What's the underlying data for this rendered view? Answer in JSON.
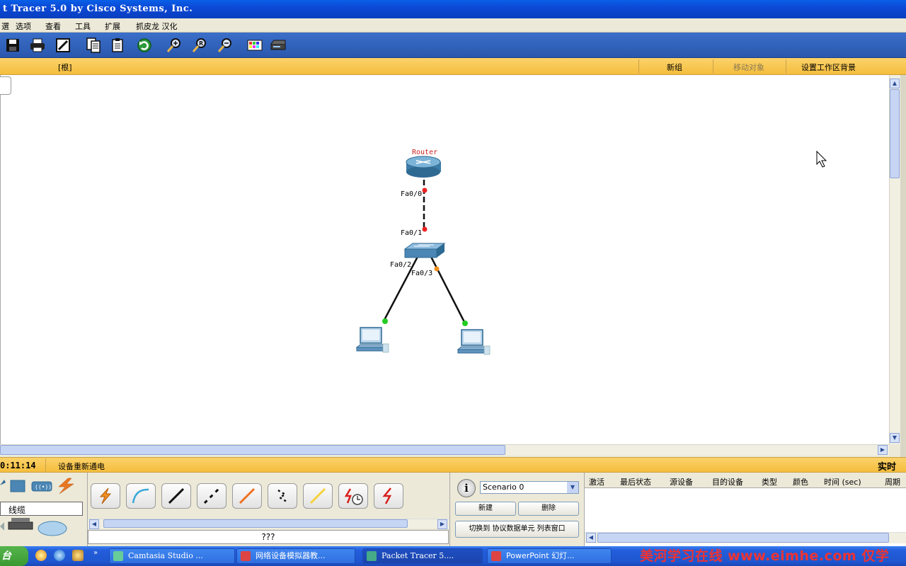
{
  "window": {
    "title": "t Tracer 5.0 by Cisco Systems, Inc."
  },
  "menu": {
    "items": [
      "選",
      "选项",
      "查看",
      "工具",
      "扩展",
      "抓皮龙 汉化"
    ]
  },
  "toolbar": {
    "icons": [
      "save-icon",
      "print-icon",
      "activity-wizard-icon",
      "copy-icon",
      "paste-icon",
      "undo-icon",
      "zoom-in-icon",
      "zoom-reset-icon",
      "zoom-out-icon",
      "palette-icon",
      "device-dialog-icon"
    ]
  },
  "navbar": {
    "root": "[根]",
    "new_cluster": "新组",
    "move_object": "移动对象",
    "set_background": "设置工作区背景"
  },
  "topology": {
    "router": {
      "label": "Router"
    },
    "ports": {
      "router_fa00": "Fa0/0",
      "switch_fa01": "Fa0/1",
      "switch_fa02": "Fa0/2",
      "switch_fa03": "Fa0/3"
    },
    "link_colors": {
      "up": "#22cc22",
      "down": "#ee2222",
      "pending": "#f0901e"
    }
  },
  "status": {
    "time": "0:11:14",
    "message": "设备重新通电",
    "mode": "实时"
  },
  "devices": {
    "category_label": "线缆"
  },
  "cables": {
    "selected_label": "???",
    "types": [
      "auto-cable",
      "console-cable",
      "straight-cable",
      "crossover-cable",
      "fiber-cable",
      "phone-cable",
      "coax-cable",
      "serial-dce-cable",
      "serial-dte-cable"
    ]
  },
  "scenario": {
    "selected": "Scenario 0",
    "new_button": "新建",
    "delete_button": "删除",
    "toggle_button": "切换到 协议数据单元 列表窗口"
  },
  "pdu_table": {
    "headers": [
      "激活",
      "最后状态",
      "源设备",
      "目的设备",
      "类型",
      "颜色",
      "时间 (sec)",
      "周期"
    ]
  },
  "taskbar": {
    "start": "台",
    "tasks": [
      "Camtasia Studio ...",
      "网络设备模拟器教...",
      "Packet Tracer 5....",
      "PowerPoint 幻灯..."
    ],
    "watermark": "美河学习在线 www.eimhe.com 仅学"
  }
}
